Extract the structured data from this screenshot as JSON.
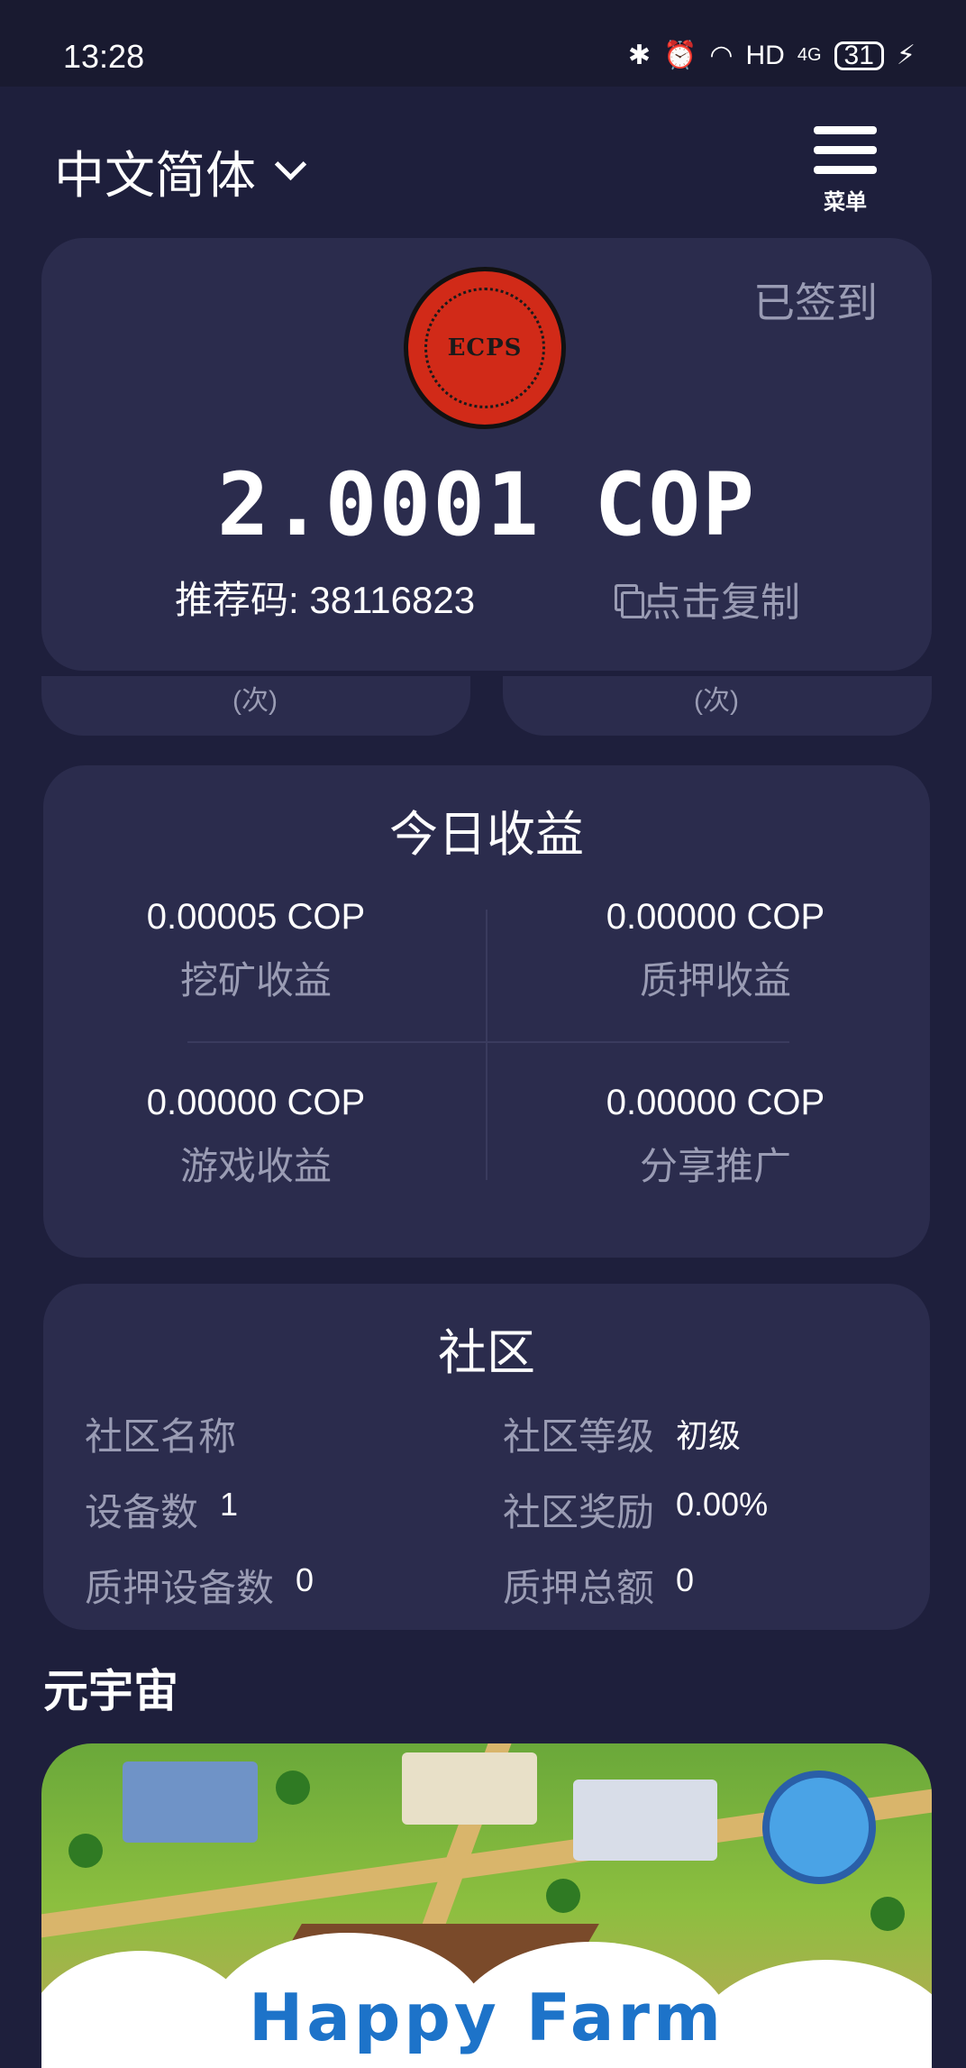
{
  "status_bar": {
    "time": "13:28",
    "icons": [
      "bluetooth-icon",
      "alarm-icon",
      "wifi-icon",
      "hd-icon",
      "signal-4g-icon"
    ],
    "hd": "HD",
    "net": "4G",
    "battery": "31"
  },
  "header": {
    "language": "中文简体",
    "menu_label": "菜单"
  },
  "account": {
    "signed_in": "已签到",
    "balance": "2.0001 COP",
    "referral": "推荐码: 38116823",
    "copy_label": "点击复制",
    "times_left": "(次)",
    "times_right": "(次)"
  },
  "income": {
    "title": "今日收益",
    "items": [
      {
        "value": "0.00005 COP",
        "label": "挖矿收益"
      },
      {
        "value": "0.00000 COP",
        "label": "质押收益"
      },
      {
        "value": "0.00000 COP",
        "label": "游戏收益"
      },
      {
        "value": "0.00000 COP",
        "label": "分享推广"
      }
    ]
  },
  "community": {
    "title": "社区",
    "name_key": "社区名称",
    "name_val": "",
    "level_key": "社区等级",
    "level_val": "初级",
    "devices_key": "设备数",
    "devices_val": "1",
    "reward_key": "社区奖励",
    "reward_val": "0.00%",
    "staked_devices_key": "质押设备数",
    "staked_devices_val": "0",
    "staked_total_key": "质押总额",
    "staked_total_val": "0"
  },
  "metaverse": {
    "title": "元宇宙",
    "banner_text": "Happy Farm",
    "logo_text": "ECPS"
  },
  "colors": {
    "background": "#1e1f3c",
    "card": "#2b2c4d",
    "muted_text": "#9a9cb4",
    "logo_red": "#d12a18"
  }
}
